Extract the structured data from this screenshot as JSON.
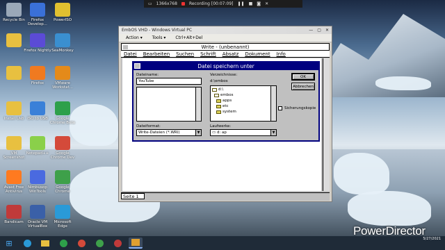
{
  "recording": {
    "resolution": "1366x768",
    "status": "Recording [00:07:09]"
  },
  "desktop_icons": [
    {
      "label": "Recycle Bin",
      "color": "#9aa8b8"
    },
    {
      "label": "Firefox Develop...",
      "color": "#3a70d8"
    },
    {
      "label": "PowerISO",
      "color": "#e0c030"
    },
    {
      "label": "",
      "color": "#e8c040"
    },
    {
      "label": "Firefox Nightly",
      "color": "#5b4bd6"
    },
    {
      "label": "SeaMonkey",
      "color": "#3a8fd0"
    },
    {
      "label": "",
      "color": "#e8c040"
    },
    {
      "label": "Firefox",
      "color": "#f07a20"
    },
    {
      "label": "VMware Workstat...",
      "color": "#e48a1a"
    },
    {
      "label": "Install Usb",
      "color": "#e8c040"
    },
    {
      "label": "ISO to USB",
      "color": "#3a80d8"
    },
    {
      "label": "Google Chrome Beta",
      "color": "#2ea04a"
    },
    {
      "label": "VM Screenshot",
      "color": "#e8c040"
    },
    {
      "label": "Notepad++",
      "color": "#8ad04a"
    },
    {
      "label": "Google Chrome Dev",
      "color": "#d44a3a"
    },
    {
      "label": "Avast Free Antivirus",
      "color": "#ff7a20"
    },
    {
      "label": "Nimbusop WinTools",
      "color": "#4a6ae0"
    },
    {
      "label": "Google Chrome",
      "color": "#3ea04a"
    },
    {
      "label": "Bandicam",
      "color": "#c03a3a"
    },
    {
      "label": "Oracle VM VirtualBox",
      "color": "#3a60a8"
    },
    {
      "label": "Microsoft Edge",
      "color": "#2a9ad8"
    }
  ],
  "vpc": {
    "title": "EmbOS VHD - Windows Virtual PC",
    "menu": [
      "Action ▾",
      "Tools ▾",
      "Ctrl+Alt+Del"
    ],
    "controls": [
      "—",
      "▢",
      "✕"
    ]
  },
  "write": {
    "title": "Write - (unbenannt)",
    "menu": [
      "Datei",
      "Bearbeiten",
      "Suchen",
      "Schrift",
      "Absatz",
      "Dokument",
      "Info"
    ],
    "page_status": "Seite 1"
  },
  "dialog": {
    "title": "Datei speichern unter",
    "filename_label": "Dateiname:",
    "filename_value": "YouTube",
    "dir_label": "Verzeichnisse:",
    "current_dir": "d:\\embos",
    "dirs": [
      "d:\\",
      "embos",
      "apps",
      "etc",
      "system"
    ],
    "ok": "OK",
    "cancel": "Abbrechen",
    "backup_label": "Sicherungskopie",
    "format_label": "Dateiformat:",
    "format_value": "Write-Dateien (*.WRI)",
    "drives_label": "Laufwerke:",
    "drive_value": "d: ap"
  },
  "watermark": "PowerDirector",
  "clock": {
    "time": "",
    "date": "5/27/2021"
  }
}
